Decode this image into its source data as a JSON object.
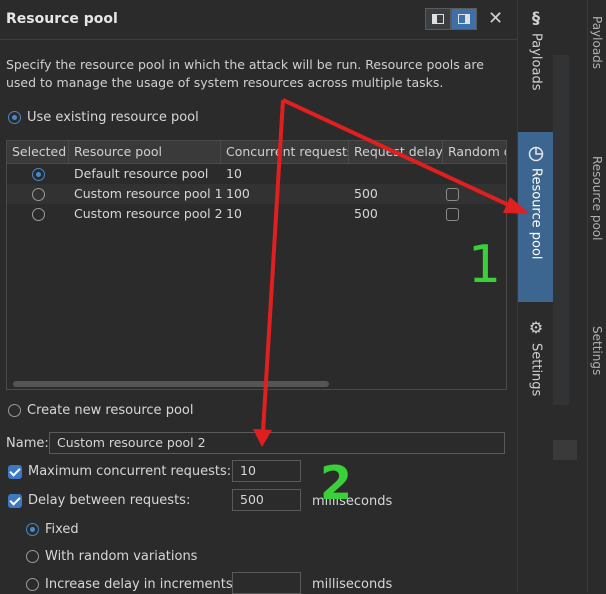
{
  "panel": {
    "title": "Resource pool",
    "description": "Specify the resource pool in which the attack will be run. Resource pools are used to manage the usage of system resources across multiple tasks.",
    "use_existing_label": "Use existing resource pool",
    "create_new_label": "Create new resource pool",
    "close_glyph": "✕"
  },
  "table": {
    "headers": [
      "Selected",
      "Resource pool",
      "Concurrent requests",
      "Request delay",
      "Random d"
    ],
    "rows": [
      {
        "selected": true,
        "name": "Default resource pool",
        "concurrent": "10",
        "delay": "",
        "random": false
      },
      {
        "selected": false,
        "name": "Custom resource pool 1",
        "concurrent": "100",
        "delay": "500",
        "random": true
      },
      {
        "selected": false,
        "name": "Custom resource pool 2",
        "concurrent": "10",
        "delay": "500",
        "random": true
      }
    ]
  },
  "form": {
    "name_label": "Name:",
    "name_value": "Custom resource pool 2",
    "max_concurrent_label": "Maximum concurrent requests:",
    "max_concurrent_value": "10",
    "delay_label": "Delay between requests:",
    "delay_value": "500",
    "ms_label": "milliseconds",
    "fixed_label": "Fixed",
    "random_label": "With random variations",
    "increase_label": "Increase delay in increments of",
    "increase_value": "",
    "increase_ms_label": "milliseconds"
  },
  "sidebar": {
    "payloads": "Payloads",
    "resource_pool": "Resource pool",
    "settings": "Settings"
  },
  "right_strip": {
    "labels": [
      "Payloads",
      "Resource pool",
      "Settings"
    ]
  },
  "annotations": {
    "label_1": "1",
    "label_2": "2",
    "arrow_color": "#e02020",
    "number_color": "#39d039"
  },
  "colors": {
    "accent": "#3d6fa8",
    "active_tab": "#3c6690"
  }
}
